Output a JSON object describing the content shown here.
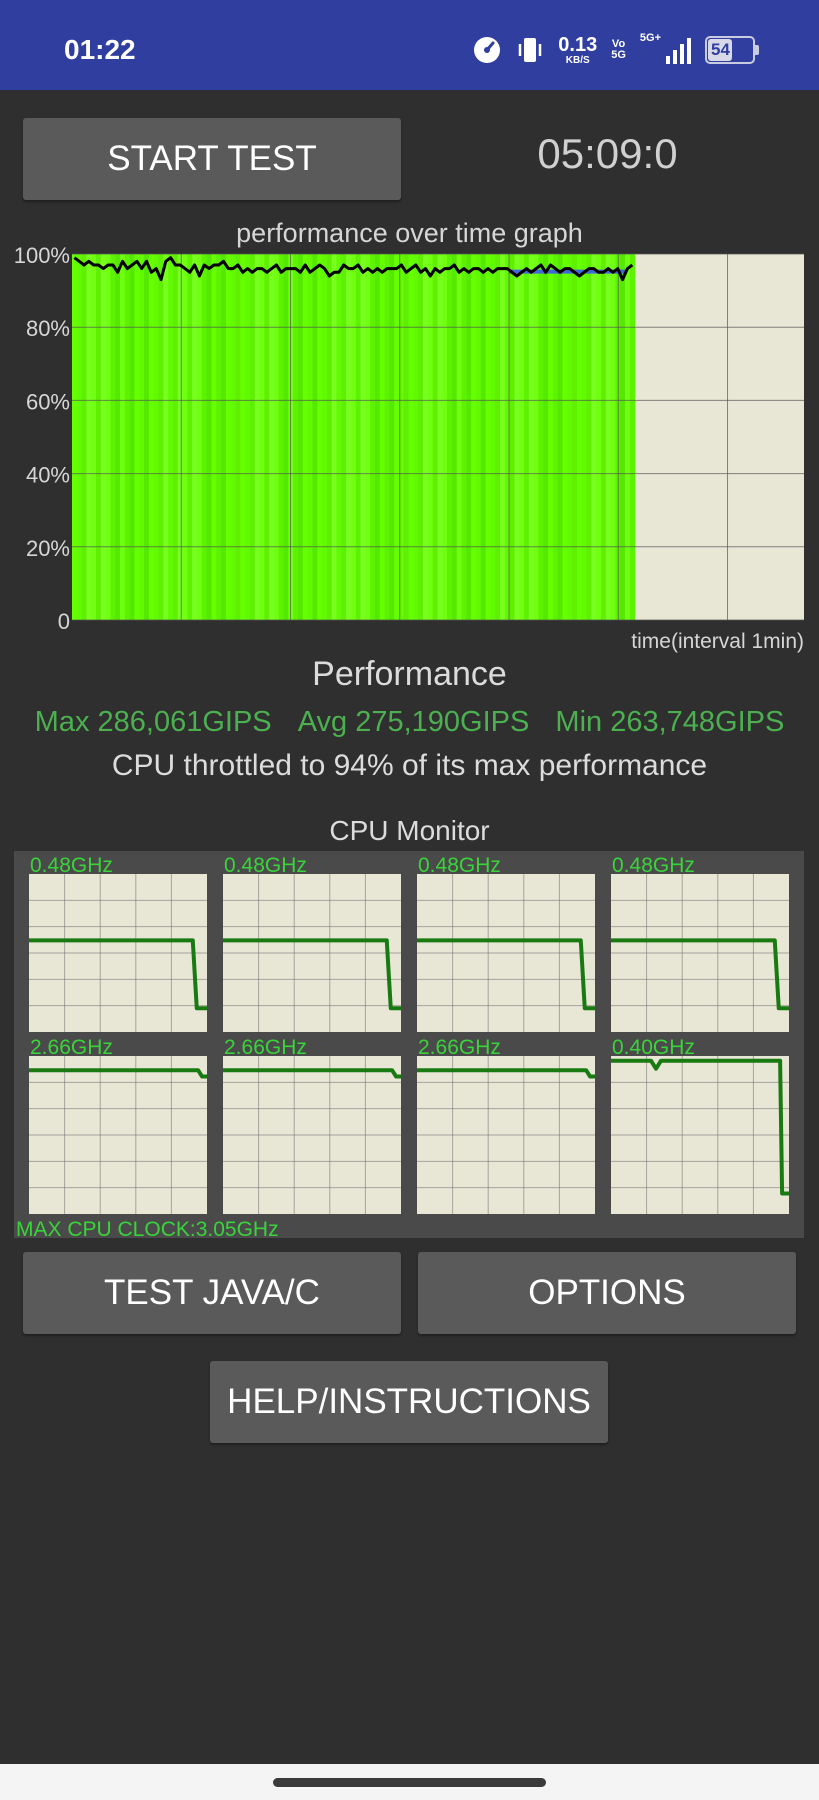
{
  "status_bar": {
    "time": "01:22",
    "net_speed_value": "0.13",
    "net_speed_unit": "KB/S",
    "vo_top": "Vo",
    "vo_bottom": "5G",
    "network": "5G+",
    "battery_percent": "54",
    "battery_level": 54,
    "icons": [
      "speedometer-icon",
      "vibrate-icon",
      "signal-icon",
      "battery-icon"
    ]
  },
  "controls": {
    "start_test_label": "START TEST",
    "timer": "05:09:0",
    "test_java_label": "TEST JAVA/C",
    "options_label": "OPTIONS",
    "help_label": "HELP/INSTRUCTIONS"
  },
  "performance": {
    "graph_title": "performance over time graph",
    "title": "Performance",
    "max": "Max 286,061GIPS",
    "avg": "Avg 275,190GIPS",
    "min": "Min 263,748GIPS",
    "throttle_text": "CPU throttled to 94% of its max performance"
  },
  "chart_data": {
    "type": "line",
    "title": "performance over time graph",
    "xlabel": "time(interval 1min)",
    "ylabel": "",
    "ylim": [
      0,
      100
    ],
    "y_ticks": [
      "100%",
      "80%",
      "60%",
      "40%",
      "20%",
      "0"
    ],
    "grid": true,
    "x_minutes_elapsed": 5.15,
    "x_minutes_total": 6.7,
    "series": [
      {
        "values": [
          99,
          98,
          97,
          98,
          97,
          97,
          96,
          97,
          97,
          95,
          98,
          96,
          97,
          98,
          96,
          98,
          95,
          96,
          93,
          98,
          99,
          97,
          97,
          96,
          95,
          97,
          94,
          97,
          96,
          97,
          97,
          98,
          96,
          96,
          97,
          95,
          96,
          95,
          96,
          96,
          95,
          96,
          97,
          95,
          96,
          96,
          96,
          95,
          97,
          95,
          96,
          97,
          96,
          94,
          95,
          95,
          97,
          96,
          96,
          97,
          95,
          96,
          95,
          96,
          95,
          96,
          96,
          96,
          97,
          95,
          96,
          97,
          95,
          96,
          94,
          96,
          95,
          96,
          96,
          97,
          95,
          96,
          95,
          96,
          96,
          95,
          96,
          95,
          96,
          96,
          96,
          95,
          94,
          95,
          96,
          95,
          96,
          97,
          95,
          97,
          96,
          95,
          96,
          96,
          95,
          94,
          95,
          96,
          96,
          95,
          95,
          96,
          95,
          96,
          93,
          96,
          97
        ]
      }
    ]
  },
  "cpu_monitor": {
    "title": "CPU Monitor",
    "max_clock_label": "MAX CPU CLOCK:3.05GHz",
    "max_clock_ghz": 3.05,
    "cores": [
      {
        "freq_label": "0.48GHz",
        "plot_level": 0.58,
        "end_level": 0.15,
        "drop_at": 0.92
      },
      {
        "freq_label": "0.48GHz",
        "plot_level": 0.58,
        "end_level": 0.15,
        "drop_at": 0.92
      },
      {
        "freq_label": "0.48GHz",
        "plot_level": 0.58,
        "end_level": 0.15,
        "drop_at": 0.92
      },
      {
        "freq_label": "0.48GHz",
        "plot_level": 0.58,
        "end_level": 0.15,
        "drop_at": 0.92
      },
      {
        "freq_label": "2.66GHz",
        "plot_level": 0.91,
        "end_level": 0.87,
        "drop_at": 0.95
      },
      {
        "freq_label": "2.66GHz",
        "plot_level": 0.91,
        "end_level": 0.87,
        "drop_at": 0.95
      },
      {
        "freq_label": "2.66GHz",
        "plot_level": 0.91,
        "end_level": 0.87,
        "drop_at": 0.95
      },
      {
        "freq_label": "0.40GHz",
        "plot_level": 0.97,
        "end_level": 0.13,
        "drop_at": 0.95
      }
    ]
  }
}
